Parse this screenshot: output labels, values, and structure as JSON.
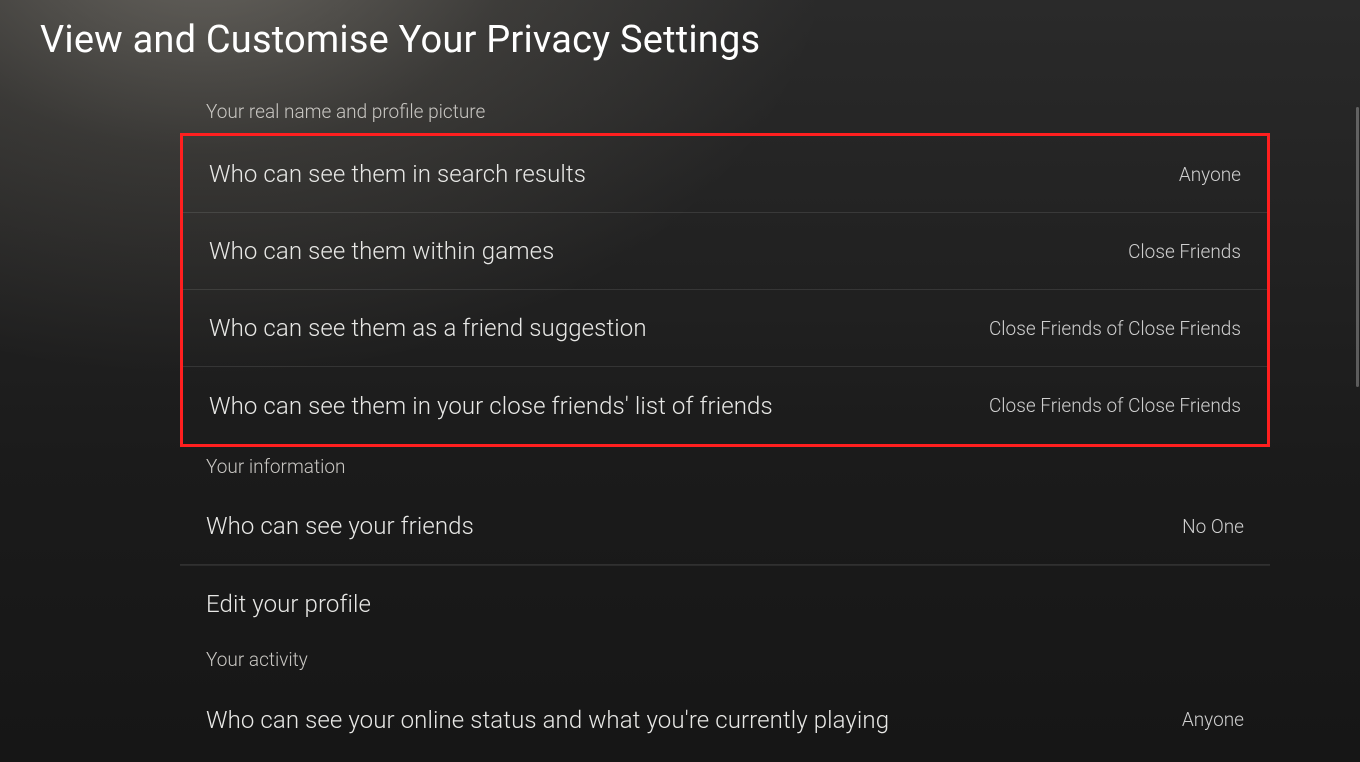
{
  "page": {
    "title": "View and Customise Your Privacy Settings"
  },
  "sections": {
    "realName": {
      "header": "Your real name and profile picture",
      "rows": [
        {
          "label": "Who can see them in search results",
          "value": "Anyone"
        },
        {
          "label": "Who can see them within games",
          "value": "Close Friends"
        },
        {
          "label": "Who can see them as a friend suggestion",
          "value": "Close Friends of Close Friends"
        },
        {
          "label": "Who can see them in your close friends' list of friends",
          "value": "Close Friends of Close Friends"
        }
      ]
    },
    "yourInfo": {
      "header": "Your information",
      "rows": [
        {
          "label": "Who can see your friends",
          "value": "No One"
        },
        {
          "label": "Edit your profile",
          "value": ""
        }
      ]
    },
    "yourActivity": {
      "header": "Your activity",
      "rows": [
        {
          "label": "Who can see your online status and what you're currently playing",
          "value": "Anyone"
        }
      ]
    }
  }
}
